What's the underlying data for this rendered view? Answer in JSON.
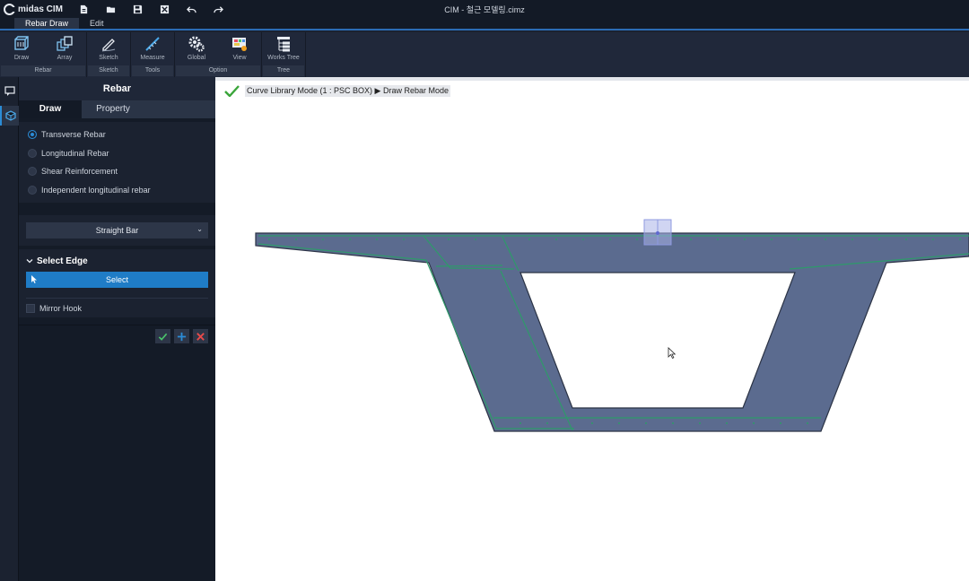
{
  "app": {
    "name": "midas CIM",
    "doc_title": "CIM - 철근 모델링.cimz"
  },
  "quick_access": [
    "new-file-icon",
    "open-folder-icon",
    "save-icon",
    "close-file-icon",
    "undo-icon",
    "redo-icon"
  ],
  "menu": {
    "tabs": [
      {
        "label": "Rebar Draw",
        "active": true
      },
      {
        "label": "Edit",
        "active": false
      }
    ]
  },
  "ribbon": {
    "groups": [
      {
        "label": "Rebar",
        "buttons": [
          {
            "label": "Draw",
            "icon": "cube-draw-icon"
          },
          {
            "label": "Array",
            "icon": "array-icon"
          }
        ]
      },
      {
        "label": "Sketch",
        "buttons": [
          {
            "label": "Sketch",
            "icon": "pencil-sketch-icon"
          }
        ]
      },
      {
        "label": "Tools",
        "buttons": [
          {
            "label": "Measure",
            "icon": "measure-icon"
          }
        ]
      },
      {
        "label": "Option",
        "buttons": [
          {
            "label": "Global",
            "icon": "gears-icon"
          },
          {
            "label": "View",
            "icon": "palette-view-icon"
          }
        ]
      },
      {
        "label": "Tree",
        "buttons": [
          {
            "label": "Works Tree",
            "icon": "tree-list-icon"
          }
        ]
      }
    ]
  },
  "panel": {
    "title": "Rebar",
    "tabs": [
      {
        "label": "Draw",
        "active": true
      },
      {
        "label": "Property",
        "active": false
      }
    ],
    "rebar_types": [
      {
        "label": "Transverse Rebar",
        "checked": true
      },
      {
        "label": "Longitudinal Rebar",
        "checked": false
      },
      {
        "label": "Shear Reinforcement",
        "checked": false
      },
      {
        "label": "Independent longitudinal rebar",
        "checked": false
      }
    ],
    "shape_select": {
      "value": "Straight Bar"
    },
    "select_edge": {
      "heading": "Select Edge",
      "button_label": "Select"
    },
    "mirror_hook": {
      "label": "Mirror Hook",
      "checked": false
    }
  },
  "canvas": {
    "mode_text": "Curve Library Mode (1 : PSC BOX) ▶ Draw Rebar Mode"
  },
  "colors": {
    "accent": "#1f7cc6",
    "section_fill": "#5a6a8e",
    "rebar_line": "#2e9a6a"
  }
}
